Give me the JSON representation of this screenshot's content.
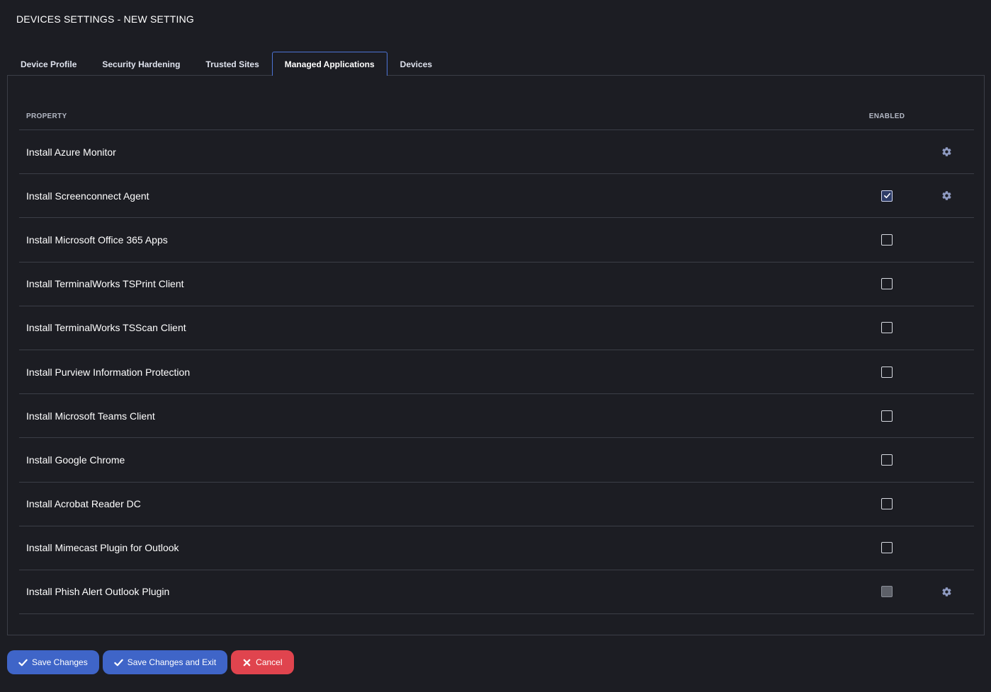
{
  "page": {
    "title": "DEVICES SETTINGS - NEW SETTING"
  },
  "tabs": [
    {
      "label": "Device Profile",
      "active": false
    },
    {
      "label": "Security Hardening",
      "active": false
    },
    {
      "label": "Trusted Sites",
      "active": false
    },
    {
      "label": "Managed Applications",
      "active": true
    },
    {
      "label": "Devices",
      "active": false
    }
  ],
  "table": {
    "headers": {
      "property": "PROPERTY",
      "enabled": "ENABLED"
    },
    "rows": [
      {
        "label": "Install Azure Monitor",
        "checkbox": "none",
        "gear": true
      },
      {
        "label": "Install Screenconnect Agent",
        "checkbox": "checked",
        "gear": true
      },
      {
        "label": "Install Microsoft Office 365 Apps",
        "checkbox": "unchecked",
        "gear": false
      },
      {
        "label": "Install TerminalWorks TSPrint Client",
        "checkbox": "unchecked",
        "gear": false
      },
      {
        "label": "Install TerminalWorks TSScan Client",
        "checkbox": "unchecked",
        "gear": false
      },
      {
        "label": "Install Purview Information Protection",
        "checkbox": "unchecked",
        "gear": false
      },
      {
        "label": "Install Microsoft Teams Client",
        "checkbox": "unchecked",
        "gear": false
      },
      {
        "label": "Install Google Chrome",
        "checkbox": "unchecked",
        "gear": false
      },
      {
        "label": "Install Acrobat Reader DC",
        "checkbox": "unchecked",
        "gear": false
      },
      {
        "label": "Install Mimecast Plugin for Outlook",
        "checkbox": "unchecked",
        "gear": false
      },
      {
        "label": "Install Phish Alert Outlook Plugin",
        "checkbox": "indeterminate",
        "gear": true
      }
    ]
  },
  "actions": {
    "save_label": "Save Changes",
    "save_exit_label": "Save Changes and Exit",
    "cancel_label": "Cancel"
  },
  "icons": {
    "check": "check-icon",
    "close": "close-icon",
    "gear": "gear-icon"
  },
  "colors": {
    "background": "#1c1d23",
    "border": "#3b3e47",
    "accent": "#3f65c8",
    "danger": "#e0444e",
    "gear": "#8f9bc2"
  }
}
